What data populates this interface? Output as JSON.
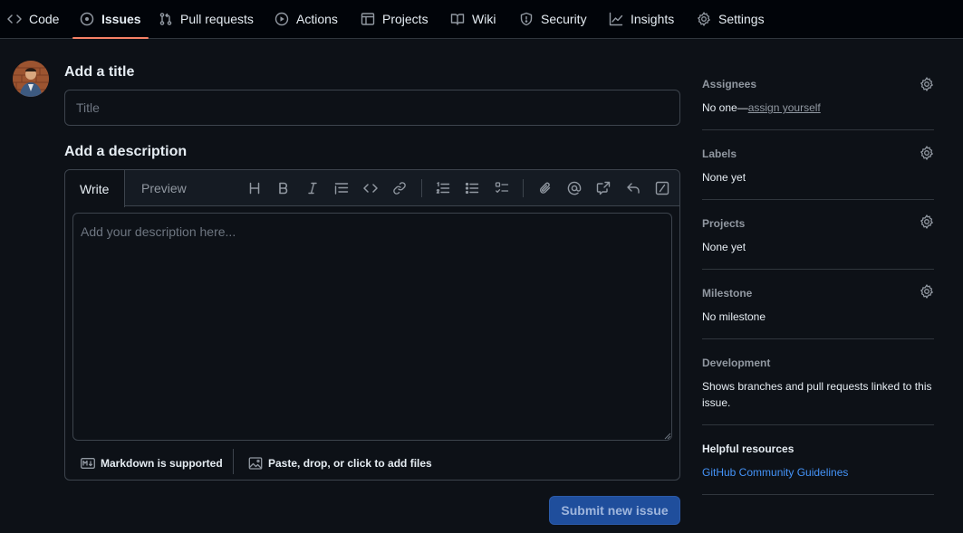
{
  "nav": {
    "items": [
      {
        "label": "Code",
        "icon": "code-icon"
      },
      {
        "label": "Issues",
        "icon": "issue-opened-icon",
        "active": true
      },
      {
        "label": "Pull requests",
        "icon": "git-pull-request-icon"
      },
      {
        "label": "Actions",
        "icon": "play-icon"
      },
      {
        "label": "Projects",
        "icon": "table-icon"
      },
      {
        "label": "Wiki",
        "icon": "book-icon"
      },
      {
        "label": "Security",
        "icon": "shield-icon"
      },
      {
        "label": "Insights",
        "icon": "graph-icon"
      },
      {
        "label": "Settings",
        "icon": "gear-icon"
      }
    ],
    "active_color": "#f78166"
  },
  "form": {
    "title_heading": "Add a title",
    "title_placeholder": "Title",
    "title_value": "",
    "description_heading": "Add a description",
    "tabs": {
      "write": "Write",
      "preview": "Preview"
    },
    "description_placeholder": "Add your description here...",
    "description_value": "",
    "markdown_note": "Markdown is supported",
    "attach_note": "Paste, drop, or click to add files",
    "submit_label": "Submit new issue"
  },
  "sidebar": {
    "assignees": {
      "title": "Assignees",
      "value_prefix": "No one—",
      "link": "assign yourself"
    },
    "labels": {
      "title": "Labels",
      "value": "None yet"
    },
    "projects": {
      "title": "Projects",
      "value": "None yet"
    },
    "milestone": {
      "title": "Milestone",
      "value": "No milestone"
    },
    "development": {
      "title": "Development",
      "value": "Shows branches and pull requests linked to this issue."
    },
    "helpful": {
      "title": "Helpful resources",
      "link": "GitHub Community Guidelines"
    }
  },
  "colors": {
    "background": "#0d1117",
    "border": "#3d444d",
    "link": "#4493f8",
    "submit_bg": "#1f4e9c"
  }
}
